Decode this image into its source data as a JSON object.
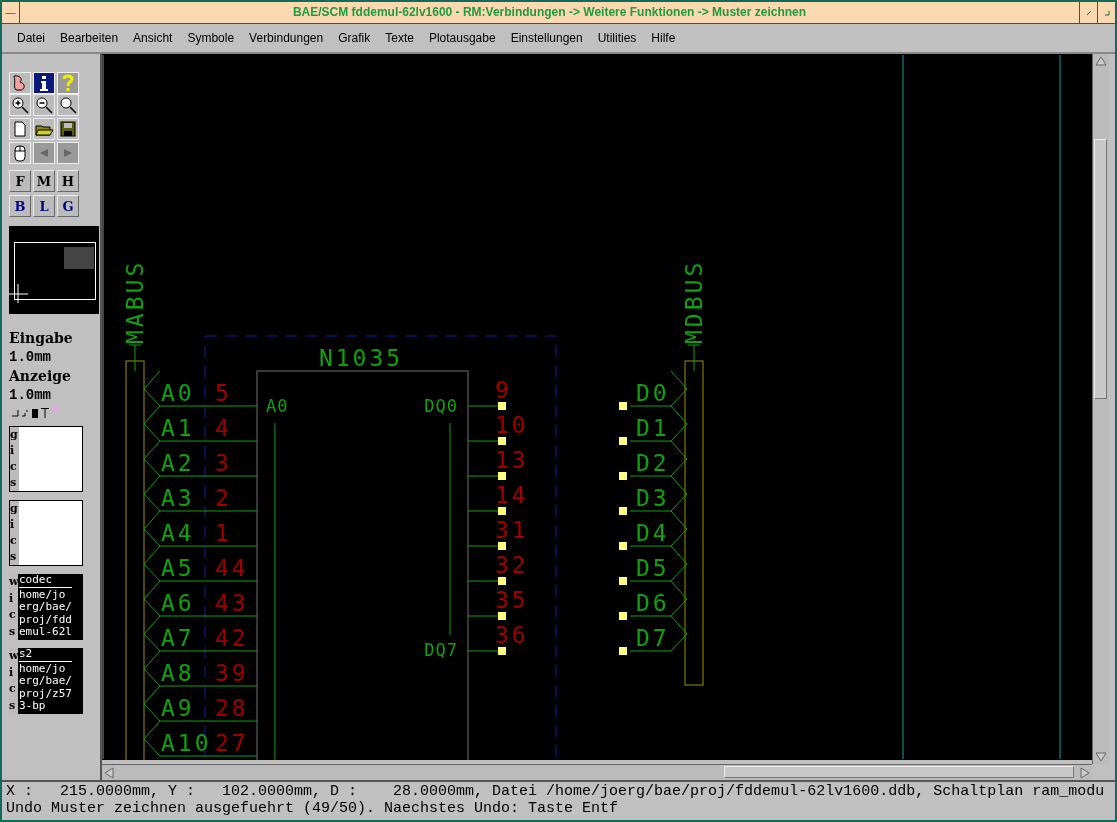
{
  "window": {
    "title": "BAE/SCM fddemul-62lv1600 - RM:Verbindungen -> Weitere Funktionen -> Muster zeichnen",
    "menu_glyph": "—"
  },
  "menu": [
    {
      "label": "Datei"
    },
    {
      "label": "Bearbeiten"
    },
    {
      "label": "Ansicht"
    },
    {
      "label": "Symbole"
    },
    {
      "label": "Verbindungen"
    },
    {
      "label": "Grafik"
    },
    {
      "label": "Texte"
    },
    {
      "label": "Plotausgabe"
    },
    {
      "label": "Einstellungen"
    },
    {
      "label": "Utilities"
    },
    {
      "label": "Hilfe"
    }
  ],
  "letter_buttons": [
    {
      "label": "F",
      "color": "#000000"
    },
    {
      "label": "M",
      "color": "#000000"
    },
    {
      "label": "H",
      "color": "#000000"
    },
    {
      "label": "B",
      "color": "#000080"
    },
    {
      "label": "L",
      "color": "#000080"
    },
    {
      "label": "G",
      "color": "#000080"
    }
  ],
  "sidebar": {
    "input_label": "Eingabe",
    "input_value": "1.0mm",
    "display_label": "Anzeige",
    "display_value": "1.0mm",
    "panels": [
      {
        "kind": "empty",
        "tabs": [
          "g",
          "i",
          "c",
          "s"
        ]
      },
      {
        "kind": "empty",
        "tabs": [
          "g",
          "i",
          "c",
          "s"
        ]
      },
      {
        "kind": "file",
        "tabs": [
          "w",
          "i",
          "c",
          "s"
        ],
        "name": "codec",
        "path_lines": [
          "home/jo",
          "erg/bae/",
          "proj/fdd",
          "emul-62l"
        ]
      },
      {
        "kind": "file",
        "tabs": [
          "w",
          "i",
          "c",
          "s"
        ],
        "name": "s2",
        "path_lines": [
          "home/jo",
          "erg/bae/",
          "proj/z57",
          "3-bp"
        ]
      }
    ]
  },
  "schematic": {
    "buses": [
      {
        "label": "MABUS"
      },
      {
        "label": "MDBUS"
      }
    ],
    "part": {
      "name": "N1035",
      "left_label": "A0",
      "right_top_label": "DQ0",
      "right_bottom_label": "DQ7"
    },
    "left_pins": [
      {
        "net": "A0",
        "pin": "5"
      },
      {
        "net": "A1",
        "pin": "4"
      },
      {
        "net": "A2",
        "pin": "3"
      },
      {
        "net": "A3",
        "pin": "2"
      },
      {
        "net": "A4",
        "pin": "1"
      },
      {
        "net": "A5",
        "pin": "44"
      },
      {
        "net": "A6",
        "pin": "43"
      },
      {
        "net": "A7",
        "pin": "42"
      },
      {
        "net": "A8",
        "pin": "39"
      },
      {
        "net": "A9",
        "pin": "28"
      },
      {
        "net": "A10",
        "pin": "27"
      }
    ],
    "right_pins": [
      {
        "pin": "9",
        "net": "D0"
      },
      {
        "pin": "10",
        "net": "D1"
      },
      {
        "pin": "13",
        "net": "D2"
      },
      {
        "pin": "14",
        "net": "D3"
      },
      {
        "pin": "31",
        "net": "D4"
      },
      {
        "pin": "32",
        "net": "D5"
      },
      {
        "pin": "35",
        "net": "D6"
      },
      {
        "pin": "36",
        "net": "D7"
      }
    ]
  },
  "status_bar": {
    "lines": [
      "X :   215.0000mm, Y :   102.0000mm, D :    28.0000mm, Datei /home/joerg/bae/proj/fddemul-62lv1600.ddb, Schaltplan ram_modu",
      "Undo Muster zeichnen ausgefuehrt (49/50). Naechstes Undo: Taste Entf"
    ]
  }
}
